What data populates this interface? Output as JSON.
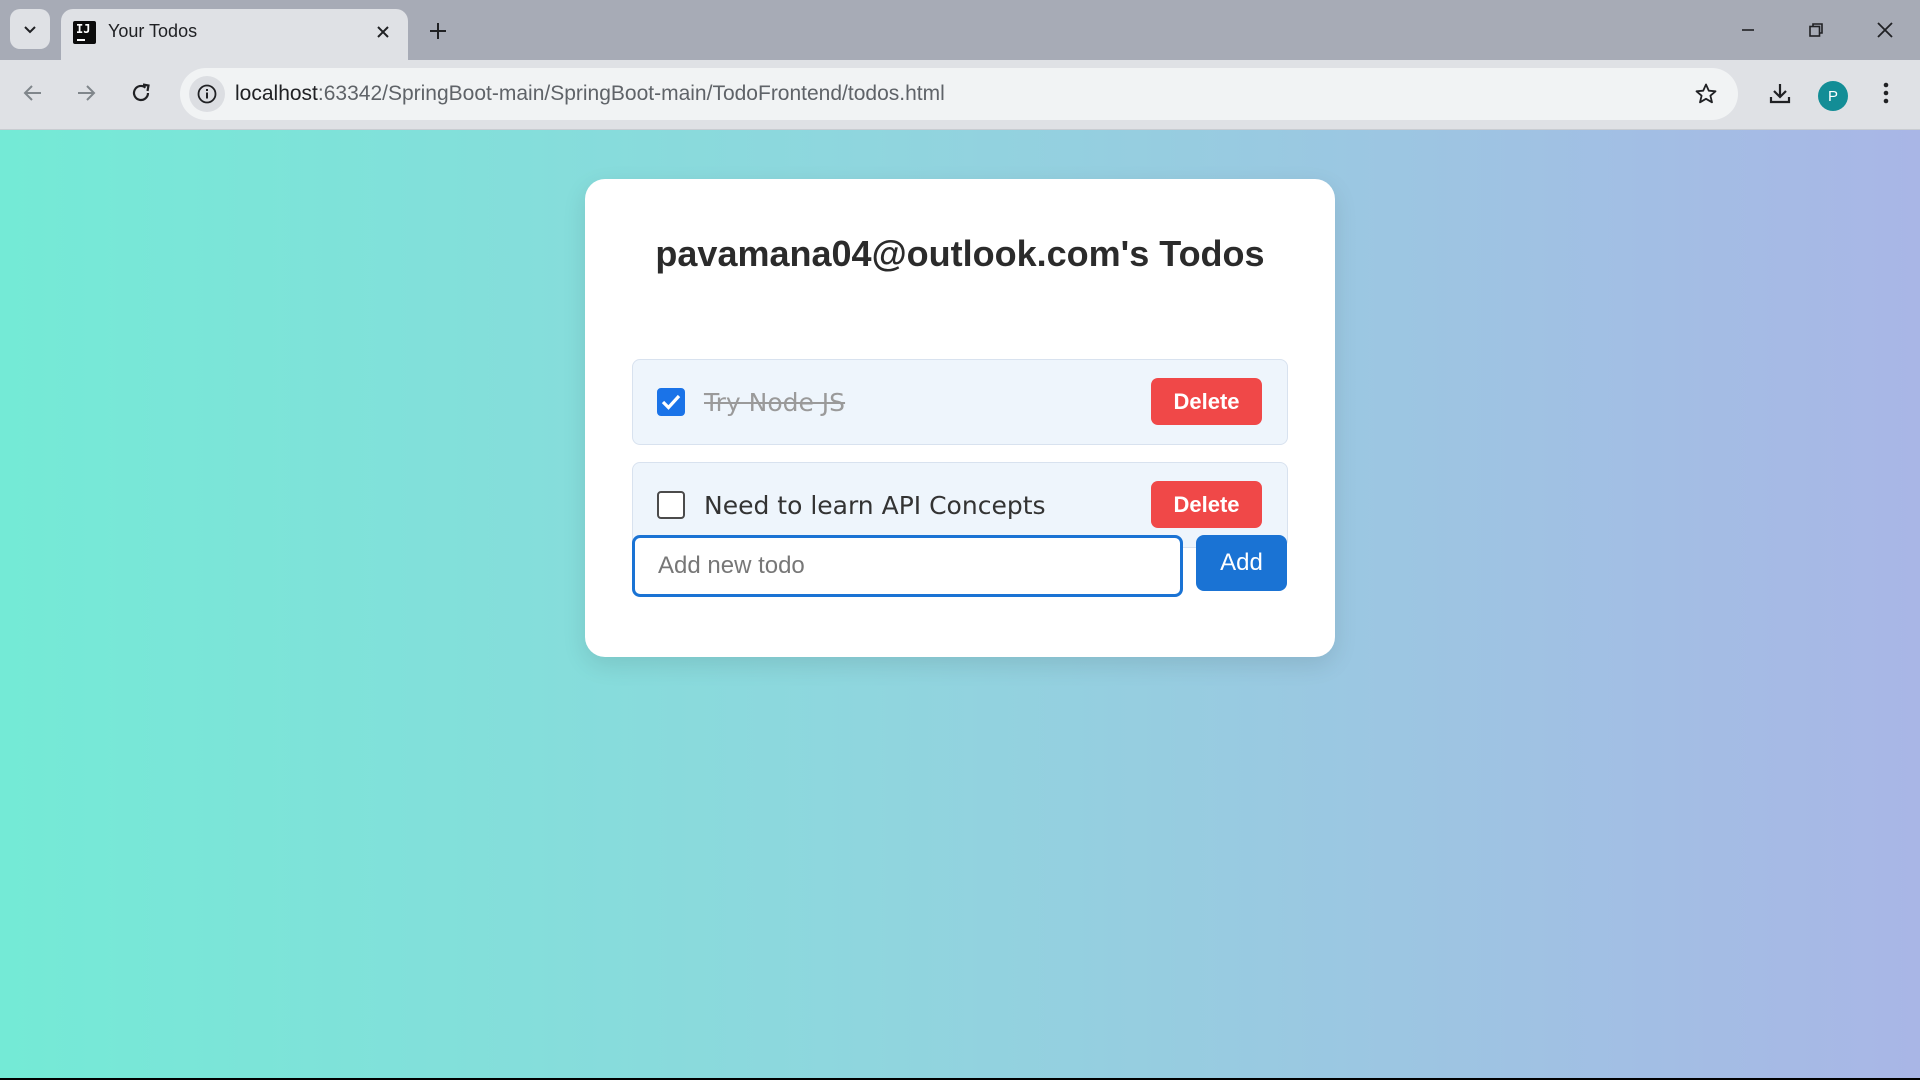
{
  "browser": {
    "tab": {
      "title": "Your Todos",
      "favicon_text": "IJ"
    },
    "address": {
      "host": "localhost",
      "path": ":63342/SpringBoot-main/SpringBoot-main/TodoFrontend/todos.html"
    },
    "profile_initial": "P"
  },
  "page": {
    "title": "pavamana04@outlook.com's Todos",
    "todos": [
      {
        "text": "Try Node JS",
        "completed": true,
        "delete_label": "Delete"
      },
      {
        "text": "Need to learn API Concepts",
        "completed": false,
        "delete_label": "Delete"
      }
    ],
    "new_todo": {
      "value": "",
      "placeholder": "Add new todo",
      "add_label": "Add"
    }
  },
  "colors": {
    "gradient_start": "#74ead6",
    "gradient_end": "#a9b6e6",
    "delete": "#f04848",
    "primary": "#1a73d4"
  }
}
